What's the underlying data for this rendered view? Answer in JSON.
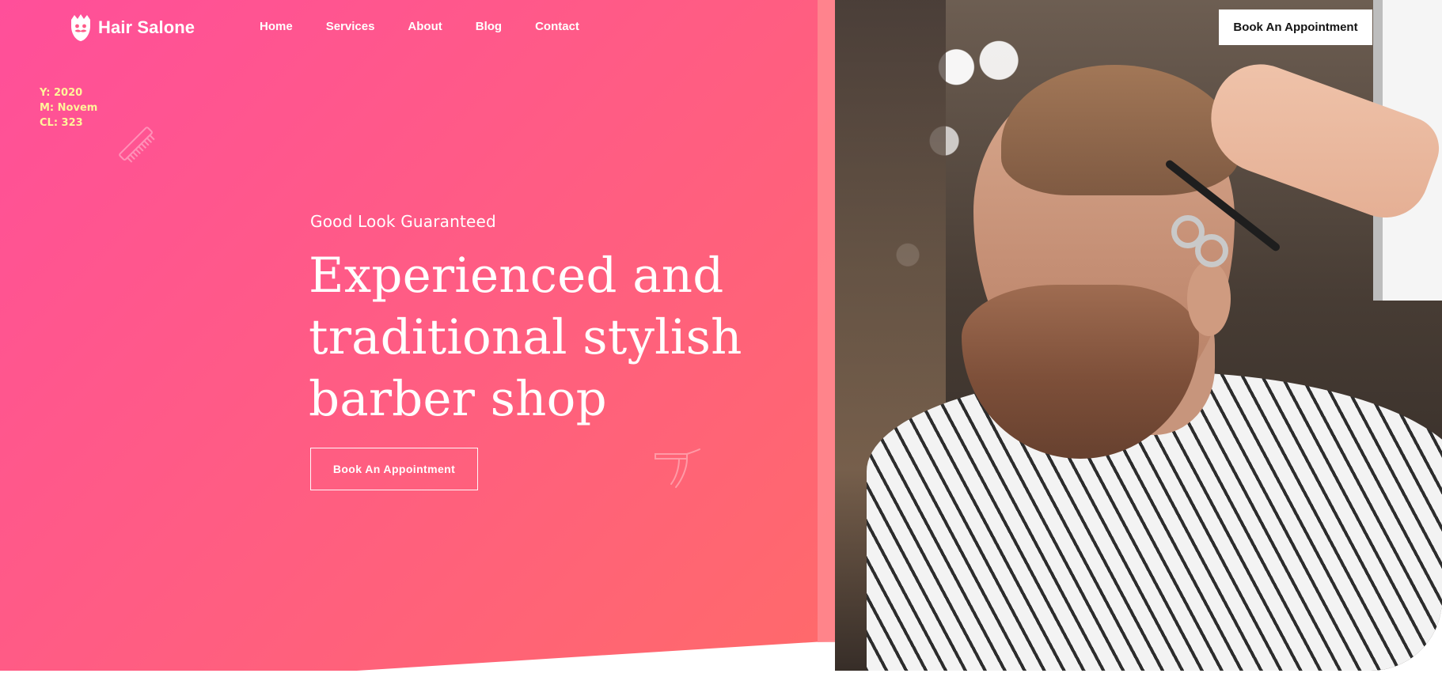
{
  "brand": {
    "name": "Hair Salone",
    "icon": "beard-face-icon"
  },
  "nav": {
    "items": [
      {
        "label": "Home"
      },
      {
        "label": "Services"
      },
      {
        "label": "About"
      },
      {
        "label": "Blog"
      },
      {
        "label": "Contact"
      }
    ]
  },
  "header": {
    "cta_label": "Book An Appointment"
  },
  "debug": {
    "year": "Y: 2020",
    "month": "M: Novem",
    "cl": "CL: 323"
  },
  "hero": {
    "eyebrow": "Good Look Guaranteed",
    "title_lines": [
      "Experienced and",
      "traditional stylish",
      "barber shop"
    ],
    "cta_label": "Book An Appointment",
    "decorative_icons": [
      "comb-icon",
      "razor-icon"
    ],
    "photo_subject": "bearded-man-getting-haircut"
  },
  "colors": {
    "gradient_start": "#ff4f9a",
    "gradient_end": "#ff6a6a",
    "accent_strip": "#ff8a8f",
    "debug_text": "#fff59a",
    "white": "#ffffff",
    "dark_text": "#151515"
  }
}
